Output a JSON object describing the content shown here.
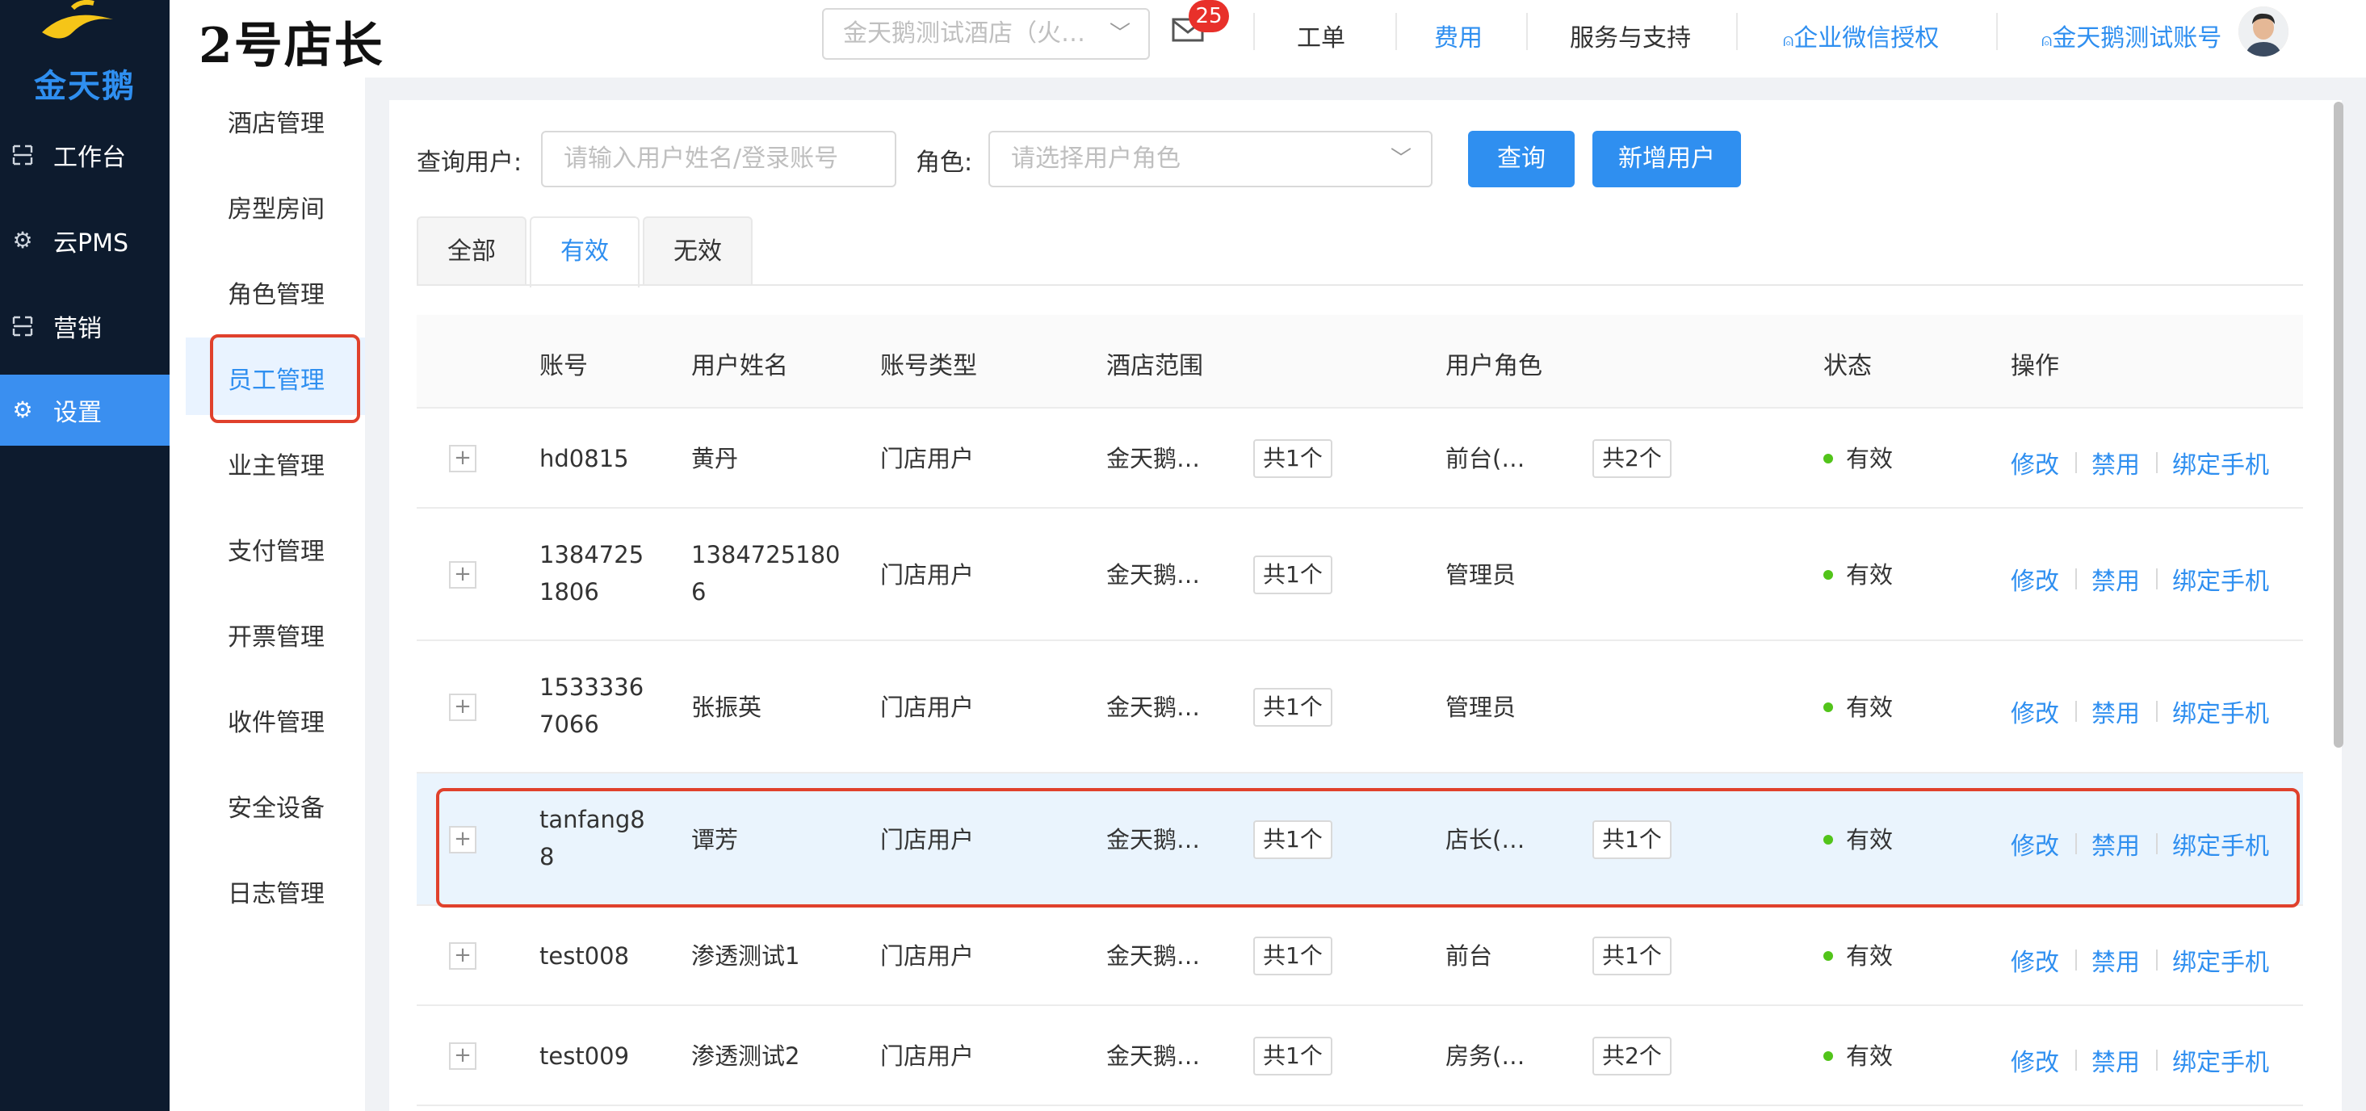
{
  "brand": {
    "logo_text": "金天鹅",
    "title": "2号店长"
  },
  "colors": {
    "accent": "#2f8ff0",
    "nav_bg": "#0d1b2e",
    "highlight": "#e0412c",
    "status_ok": "#52c41a"
  },
  "nav": [
    {
      "label": "工作台",
      "icon": "desktop-icon"
    },
    {
      "label": "云PMS",
      "icon": "gear-icon"
    },
    {
      "label": "营销",
      "icon": "scan-icon"
    },
    {
      "label": "设置",
      "icon": "gear-icon",
      "active": true
    }
  ],
  "header": {
    "hotel_select": "金天鹅测试酒店（火…",
    "mail_badge": "25",
    "links": [
      "工单",
      "费用",
      "服务与支持",
      "企业微信授权",
      "金天鹅测试账号"
    ]
  },
  "submenu": [
    "酒店管理",
    "房型房间",
    "角色管理",
    "员工管理",
    "业主管理",
    "支付管理",
    "开票管理",
    "收件管理",
    "安全设备",
    "日志管理"
  ],
  "filters": {
    "user_label": "查询用户:",
    "user_placeholder": "请输入用户姓名/登录账号",
    "role_label": "角色:",
    "role_placeholder": "请选择用户角色",
    "query_button": "查询",
    "add_button": "新增用户"
  },
  "tabs": [
    "全部",
    "有效",
    "无效"
  ],
  "table": {
    "columns": [
      "账号",
      "用户姓名",
      "账号类型",
      "酒店范围",
      "用户角色",
      "状态",
      "操作"
    ],
    "actions": [
      "修改",
      "禁用",
      "绑定手机"
    ],
    "rows": [
      {
        "account": [
          "hd0815"
        ],
        "name": [
          "黄丹"
        ],
        "type": "门店用户",
        "hotel": "金天鹅…",
        "hotel_count": "共1个",
        "role": "前台(…",
        "role_count": "共2个",
        "status": "有效"
      },
      {
        "account": [
          "1384725",
          "1806"
        ],
        "name": [
          "1384725180",
          "6"
        ],
        "type": "门店用户",
        "hotel": "金天鹅…",
        "hotel_count": "共1个",
        "role": "管理员",
        "role_count": "",
        "status": "有效"
      },
      {
        "account": [
          "1533336",
          "7066"
        ],
        "name": [
          "张振英"
        ],
        "type": "门店用户",
        "hotel": "金天鹅…",
        "hotel_count": "共1个",
        "role": "管理员",
        "role_count": "",
        "status": "有效"
      },
      {
        "account": [
          "tanfang8",
          "8"
        ],
        "name": [
          "谭芳"
        ],
        "type": "门店用户",
        "hotel": "金天鹅…",
        "hotel_count": "共1个",
        "role": "店长(…",
        "role_count": "共1个",
        "status": "有效"
      },
      {
        "account": [
          "test008"
        ],
        "name": [
          "渗透测试1"
        ],
        "type": "门店用户",
        "hotel": "金天鹅…",
        "hotel_count": "共1个",
        "role": "前台",
        "role_count": "共1个",
        "status": "有效"
      },
      {
        "account": [
          "test009"
        ],
        "name": [
          "渗透测试2"
        ],
        "type": "门店用户",
        "hotel": "金天鹅…",
        "hotel_count": "共1个",
        "role": "房务(…",
        "role_count": "共2个",
        "status": "有效"
      }
    ]
  }
}
